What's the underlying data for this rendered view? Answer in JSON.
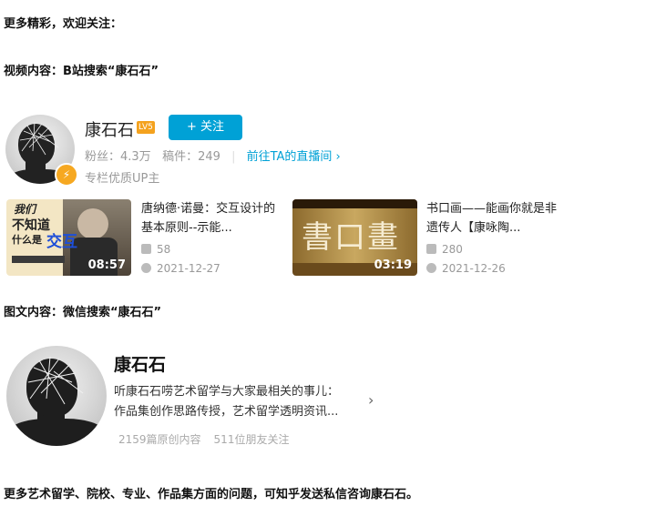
{
  "intro": {
    "more": "更多精彩，欢迎关注：",
    "video": "视频内容：B站搜索“康石石”",
    "article": "图文内容：微信搜索“康石石”",
    "footer": "更多艺术留学、院校、专业、作品集方面的问题，可知乎发送私信咨询康石石。"
  },
  "bili": {
    "name": "康石石",
    "level": "LV5",
    "follow_label": "+ 关注",
    "fans": "粉丝：4.3万",
    "articles": "稿件：249",
    "live_link": "前往TA的直播间 ›",
    "badge": "专栏优质UP主",
    "videos": [
      {
        "thumb_text_1": "我们",
        "thumb_text_2": "不知道",
        "thumb_text_3": "什么是",
        "thumb_text_4": "交互",
        "duration": "08:57",
        "title": "唐纳德·诺曼：交互设计的基本原则--示能...",
        "plays": "58",
        "date": "2021-12-27"
      },
      {
        "thumb_text_1": "書口畫",
        "duration": "03:19",
        "title": "书口画——能画你就是非遗传人【康咏陶...",
        "plays": "280",
        "date": "2021-12-26"
      }
    ]
  },
  "wechat": {
    "name": "康石石",
    "desc_line1": "听康石石唠艺术留学与大家最相关的事儿：",
    "desc_line2": "作品集创作思路传授，艺术留学透明资讯...",
    "original_count": "2159篇原创内容",
    "friends_follow": "511位朋友关注"
  },
  "colors": {
    "bili_blue": "#00a1d6",
    "level_orange": "#f4a21e"
  }
}
